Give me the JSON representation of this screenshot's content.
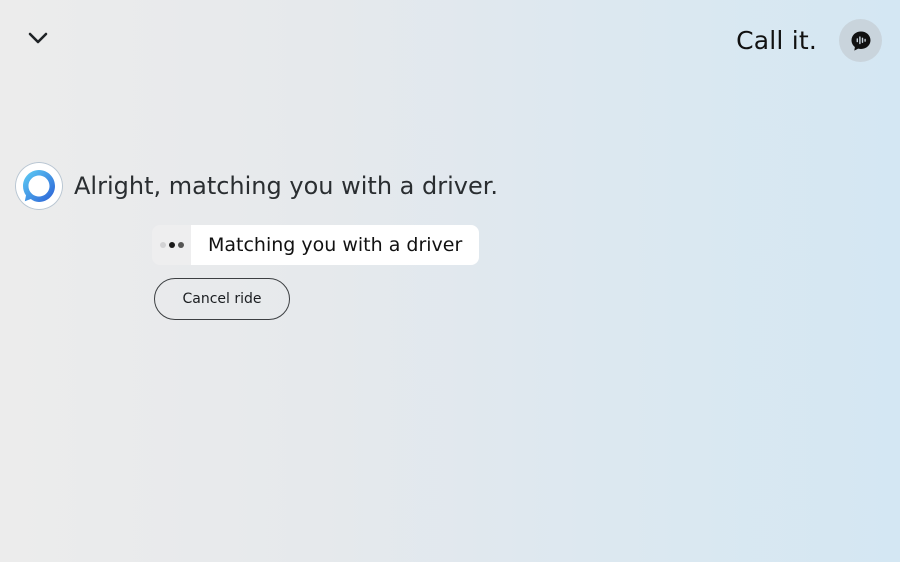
{
  "header": {
    "collapse_icon": "chevron-down-icon",
    "utterance": "Call it.",
    "mic_icon": "speech-bubble-waveform-icon"
  },
  "conversation": {
    "assistant_icon": "alexa-ring-icon",
    "response": "Alright, matching you with a driver.",
    "status": {
      "indicator_icon": "loading-dots-icon",
      "label": "Matching you with a driver"
    },
    "actions": {
      "cancel_label": "Cancel ride"
    }
  },
  "colors": {
    "alexa_blue": "#31a9e6",
    "alexa_dark_blue": "#2a5fd6",
    "mic_bg": "#c9d4dc"
  }
}
